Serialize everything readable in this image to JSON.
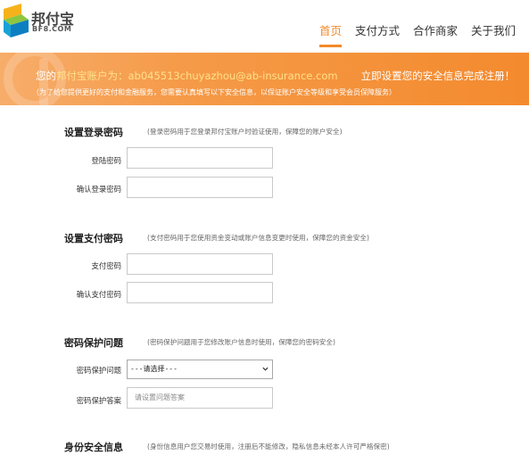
{
  "brand": {
    "name": "邦付宝",
    "domain": "BF8.COM"
  },
  "nav": {
    "items": [
      {
        "label": "首页",
        "active": true
      },
      {
        "label": "支付方式",
        "active": false
      },
      {
        "label": "合作商家",
        "active": false
      },
      {
        "label": "关于我们",
        "active": false
      }
    ]
  },
  "banner": {
    "prefix": "您的",
    "account_label": "邦付宝账户为：",
    "account": "ab045513chuyazhou@ab-insurance.com",
    "call_to_action": "立即设置您的安全信息完成注册！",
    "subtext": "（为了给您提供更好的支付和金融服务，您需要认真填写以下安全信息，以保证账户安全等级和享受会员保障服务）"
  },
  "sections": {
    "login_password": {
      "title": "设置登录密码",
      "note": "(登录密码用于您登录邦付宝账户时验证使用，保障您的账户安全)",
      "password_label": "登陆密码",
      "password_value": "",
      "confirm_label": "确认登录密码",
      "confirm_value": ""
    },
    "pay_password": {
      "title": "设置支付密码",
      "note": "(支付密码用于您使用资金变动或账户信息变更时使用，保障您的资金安全)",
      "password_label": "支付密码",
      "password_value": "",
      "confirm_label": "确认支付密码",
      "confirm_value": ""
    },
    "security_question": {
      "title": "密码保护问题",
      "note": "(密码保护问题用于您修改账户信息时使用，保障您的密码安全)",
      "question_label": "密码保护问题",
      "question_selected": "---请选择---",
      "answer_label": "密码保护答案",
      "answer_placeholder": "请设置问题答案"
    },
    "identity": {
      "title": "身份安全信息",
      "note": "(身份信息用户您交易时使用，注册后不能修改，隐私信息未经本人许可严格保密)"
    }
  },
  "colors": {
    "accent": "#f28a2c",
    "banner_highlight": "#ffe28a"
  }
}
